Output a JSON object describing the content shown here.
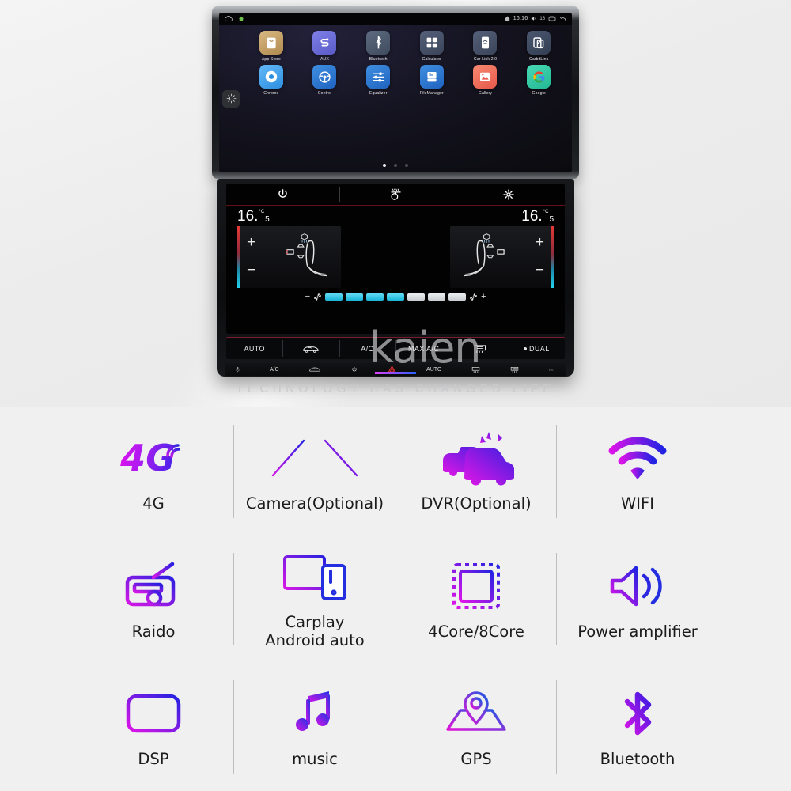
{
  "head_unit": {
    "status_bar": {
      "cloud_icon": "cloud-icon",
      "home_icon": "home-icon",
      "signal_icon": "signal-icon",
      "time": "16:16",
      "volume_icon": "volume-icon",
      "volume_level": "16",
      "recents_icon": "recents-icon",
      "back_icon": "back-icon"
    },
    "side_button": "settings-gear-icon",
    "apps": [
      {
        "label": "App Store",
        "icon": "bag-icon",
        "bg": "#c8a46a"
      },
      {
        "label": "AUX",
        "icon": "aux-cable-icon",
        "bg": "#6b6bd6"
      },
      {
        "label": "Bluetooth",
        "icon": "bluetooth-icon",
        "bg": "#4d5a6e"
      },
      {
        "label": "Calculator",
        "icon": "calculator-icon",
        "bg": "#46506a"
      },
      {
        "label": "Car Link 2.0",
        "icon": "phone-car-icon",
        "bg": "#46506a"
      },
      {
        "label": "CarbitLink",
        "icon": "screen-mirror-icon",
        "bg": "#3d4a63"
      },
      {
        "label": "Chrome",
        "icon": "chrome-icon",
        "bg": "#3fa9f5"
      },
      {
        "label": "Control",
        "icon": "steering-wheel-icon",
        "bg": "#2f7ed8"
      },
      {
        "label": "Equalizer",
        "icon": "sliders-icon",
        "bg": "#2f7ed8"
      },
      {
        "label": "FileManager",
        "icon": "file-drawer-icon",
        "bg": "#2f7ed8"
      },
      {
        "label": "Gallery",
        "icon": "photo-icon",
        "bg": "#f06a5a"
      },
      {
        "label": "Google",
        "icon": "google-g-icon",
        "bg": "#2bc7a6"
      }
    ],
    "page_dots": {
      "count": 3,
      "active_index": 0
    }
  },
  "climate": {
    "top_buttons": [
      "power-icon",
      "steering-heat-icon",
      "gear-icon"
    ],
    "temperature_left": {
      "integer": "16.",
      "decimal": "5",
      "unit": "°C"
    },
    "temperature_right": {
      "integer": "16.",
      "decimal": "5",
      "unit": "°C"
    },
    "plus": "+",
    "minus": "−",
    "fan": {
      "minus": "−",
      "plus": "+",
      "segments_on": 4,
      "segments_total": 7,
      "fan_icon": "fan-icon"
    },
    "buttons": [
      {
        "label": "AUTO",
        "type": "text"
      },
      {
        "label": "",
        "type": "icon",
        "icon": "car-recirculate-icon"
      },
      {
        "label": "A/C",
        "type": "text"
      },
      {
        "label": "MAX A/C",
        "type": "text"
      },
      {
        "label": "",
        "type": "icon",
        "icon": "rear-defrost-icon"
      },
      {
        "label": "DUAL",
        "type": "text"
      }
    ],
    "hardware_buttons": [
      {
        "label": "MIC",
        "icon": "mic-icon"
      },
      {
        "label": "A/C",
        "icon": ""
      },
      {
        "label": "",
        "icon": "front-defrost-icon"
      },
      {
        "label": "",
        "icon": "power-icon"
      },
      {
        "label": "",
        "icon": "hazard-icon"
      },
      {
        "label": "AUTO",
        "icon": ""
      },
      {
        "label": "",
        "icon": "windshield-defrost-icon"
      },
      {
        "label": "",
        "icon": "rear-window-defrost-icon"
      },
      {
        "label": "RST",
        "icon": ""
      }
    ]
  },
  "brand": {
    "watermark": "kaien",
    "tagline": "TECHNOLOGY HAS CHANGED LIFE"
  },
  "features": [
    {
      "icon": "4g-icon",
      "label": "4G",
      "label2": ""
    },
    {
      "icon": "camera-guideline-icon",
      "label": "Camera(Optional)",
      "label2": ""
    },
    {
      "icon": "dvr-car-icon",
      "label": "DVR(Optional)",
      "label2": ""
    },
    {
      "icon": "wifi-icon",
      "label": "WIFI",
      "label2": ""
    },
    {
      "icon": "radio-icon",
      "label": "Raido",
      "label2": ""
    },
    {
      "icon": "carplay-devices-icon",
      "label": "Carplay",
      "label2": "Android auto"
    },
    {
      "icon": "cpu-chip-icon",
      "label": "4Core/8Core",
      "label2": ""
    },
    {
      "icon": "speaker-icon",
      "label": "Power amplifier",
      "label2": ""
    },
    {
      "icon": "dsp-waveform-icon",
      "label": "DSP",
      "label2": ""
    },
    {
      "icon": "music-note-icon",
      "label": "music",
      "label2": ""
    },
    {
      "icon": "gps-pin-map-icon",
      "label": "GPS",
      "label2": ""
    },
    {
      "icon": "bluetooth-icon",
      "label": "Bluetooth",
      "label2": ""
    }
  ],
  "colors": {
    "accent_start": "#e040fb",
    "accent_end": "#2962ff",
    "page_bg": "#f0f0f0"
  }
}
